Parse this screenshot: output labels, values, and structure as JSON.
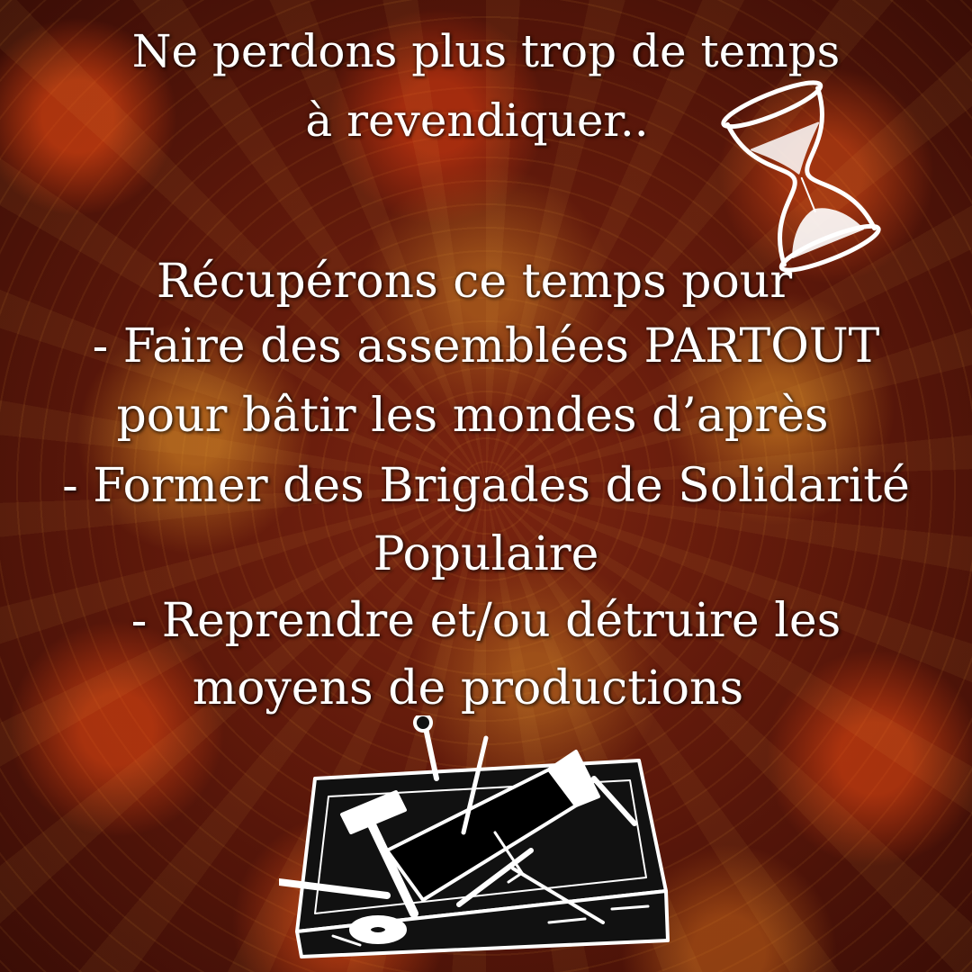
{
  "headline": {
    "line1": "Ne perdons plus trop de temps",
    "line2": "à revendiquer.."
  },
  "body": {
    "intro": "Récupérons ce temps pour",
    "line1": "- Faire des assemblées PARTOUT",
    "line2": "pour bâtir les mondes d’après",
    "line3": "- Former des Brigades de Solidarité",
    "line4": "Populaire",
    "line5": "- Reprendre et/ou détruire les",
    "line6": "moyens de productions"
  },
  "icons": {
    "hourglass": "hourglass-icon",
    "toolbox": "toolbox-icon"
  },
  "colors": {
    "text": "#ffffff",
    "background_dark": "#4a1208",
    "background_accent": "#e0962a"
  }
}
